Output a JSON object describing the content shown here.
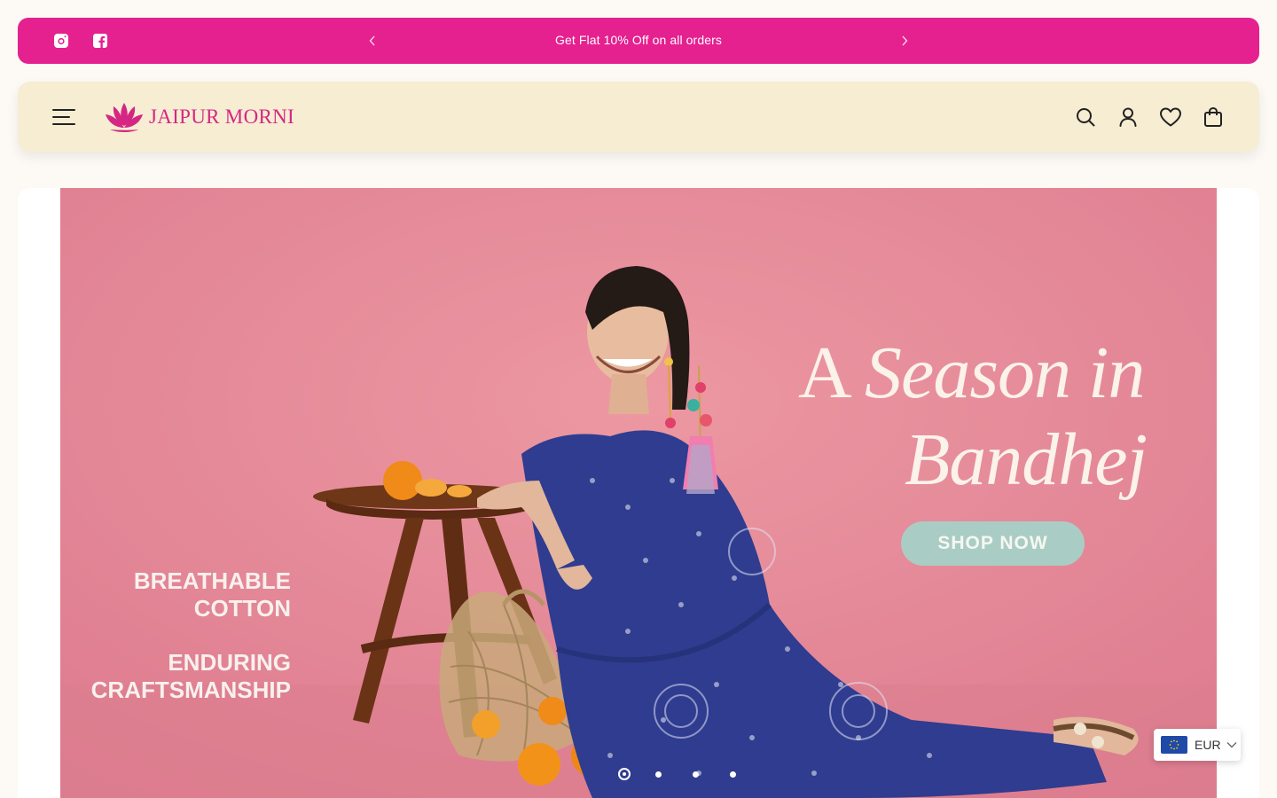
{
  "announcement": {
    "message": "Get Flat 10% Off on all orders",
    "background": "#e5208f"
  },
  "social": {
    "instagram_icon": "instagram-icon",
    "facebook_icon": "facebook-icon"
  },
  "header": {
    "brand": "JAIPUR MORNI",
    "brand_color": "#d62684",
    "background": "#f6edd2",
    "icons": [
      "menu-icon",
      "search-icon",
      "account-icon",
      "wishlist-icon",
      "bag-icon"
    ]
  },
  "hero": {
    "headline_word_1": "A",
    "headline_word_2": "Season in",
    "headline_line_2": "Bandhej",
    "cta": "SHOP NOW",
    "feature_1_line_1": "BREATHABLE",
    "feature_1_line_2": "COTTON",
    "feature_2_line_1": "ENDURING",
    "feature_2_line_2": "CRAFTSMANSHIP",
    "slide_count": 4,
    "active_slide": 1
  },
  "currency": {
    "code": "EUR"
  }
}
